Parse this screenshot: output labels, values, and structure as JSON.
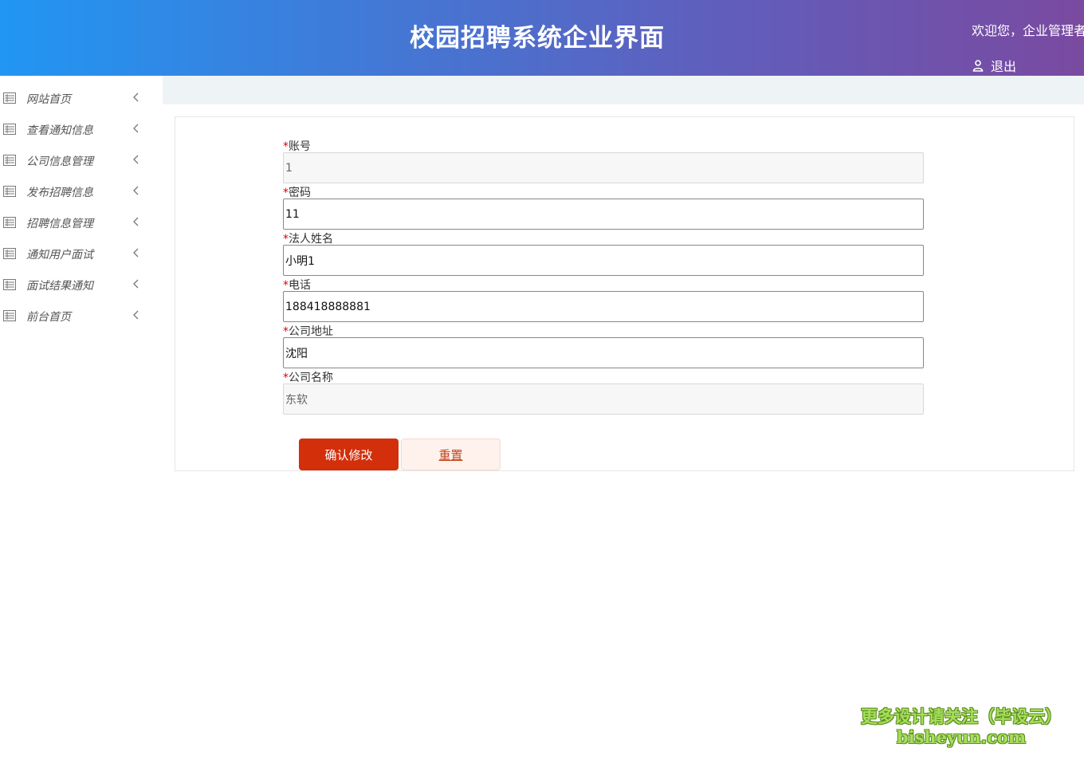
{
  "header": {
    "title": "校园招聘系统企业界面",
    "welcome": "欢迎您，企业管理者",
    "logout_label": "退出",
    "logout_icon": "user-icon"
  },
  "sidebar": {
    "items": [
      {
        "label": "网站首页",
        "icon": "list-icon"
      },
      {
        "label": "查看通知信息",
        "icon": "list-icon"
      },
      {
        "label": "公司信息管理",
        "icon": "list-icon"
      },
      {
        "label": "发布招聘信息",
        "icon": "list-icon"
      },
      {
        "label": "招聘信息管理",
        "icon": "list-icon"
      },
      {
        "label": "通知用户面试",
        "icon": "list-icon"
      },
      {
        "label": "面试结果通知",
        "icon": "list-icon"
      },
      {
        "label": "前台首页",
        "icon": "list-icon"
      }
    ]
  },
  "form": {
    "required_mark": "*",
    "fields": [
      {
        "label": "账号",
        "value": "1",
        "readonly": true
      },
      {
        "label": "密码",
        "value": "11",
        "readonly": false
      },
      {
        "label": "法人姓名",
        "value": "小明1",
        "readonly": false
      },
      {
        "label": "电话",
        "value": "188418888881",
        "readonly": false
      },
      {
        "label": "公司地址",
        "value": "沈阳",
        "readonly": false
      },
      {
        "label": "公司名称",
        "value": "东软",
        "readonly": true
      }
    ],
    "confirm_label": "确认修改",
    "reset_label": "重置"
  },
  "watermark": {
    "line1": "更多设计请关注（毕设云）",
    "line2": "bisheyun.com"
  },
  "colors": {
    "header_gradient_start": "#2196f3",
    "header_gradient_end": "#7a4aa0",
    "confirm_button": "#d32f0b",
    "reset_button_bg": "#fff1ec",
    "required_mark": "#e00000"
  }
}
